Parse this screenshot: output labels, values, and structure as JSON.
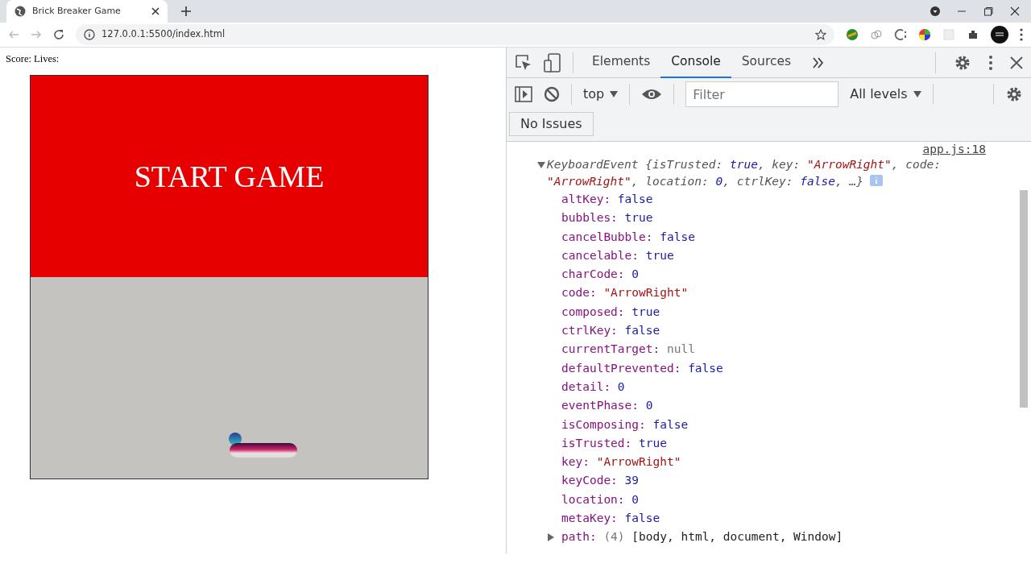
{
  "browser": {
    "tabs": [
      {
        "title": "Brick Breaker Game",
        "selected": true
      }
    ],
    "address": "127.0.0.1:5500/index.html"
  },
  "page": {
    "status": "Score: Lives:",
    "game": {
      "overlay_text": "START GAME"
    }
  },
  "devtools": {
    "tabs": [
      {
        "label": "Elements",
        "selected": false
      },
      {
        "label": "Console",
        "selected": true
      },
      {
        "label": "Sources",
        "selected": false
      }
    ],
    "context": "top",
    "filter": {
      "placeholder": "Filter"
    },
    "levels": "All levels",
    "issues": "No Issues",
    "log": {
      "source": "app.js:18",
      "expanded": true,
      "summary": [
        {
          "text": "KeyboardEvent {isTrusted: ",
          "kind": "plain"
        },
        {
          "text": "true",
          "kind": "value"
        },
        {
          "text": ", key: ",
          "kind": "plain"
        },
        {
          "text": "\"ArrowRight\"",
          "kind": "string"
        },
        {
          "text": ", code: ",
          "kind": "plain"
        },
        {
          "text": "\"ArrowRight\"",
          "kind": "string"
        },
        {
          "text": ", location: ",
          "kind": "plain"
        },
        {
          "text": "0",
          "kind": "value"
        },
        {
          "text": ", ctrlKey: ",
          "kind": "plain"
        },
        {
          "text": "false",
          "kind": "value"
        },
        {
          "text": ", …}",
          "kind": "plain"
        }
      ],
      "properties": [
        {
          "key": "altKey:",
          "value": "false",
          "kind": "value"
        },
        {
          "key": "bubbles:",
          "value": "true",
          "kind": "value"
        },
        {
          "key": "cancelBubble:",
          "value": "false",
          "kind": "value"
        },
        {
          "key": "cancelable:",
          "value": "true",
          "kind": "value"
        },
        {
          "key": "charCode:",
          "value": "0",
          "kind": "value"
        },
        {
          "key": "code:",
          "value": "\"ArrowRight\"",
          "kind": "string"
        },
        {
          "key": "composed:",
          "value": "true",
          "kind": "value"
        },
        {
          "key": "ctrlKey:",
          "value": "false",
          "kind": "value"
        },
        {
          "key": "currentTarget:",
          "value": "null",
          "kind": "null"
        },
        {
          "key": "defaultPrevented:",
          "value": "false",
          "kind": "value"
        },
        {
          "key": "detail:",
          "value": "0",
          "kind": "value"
        },
        {
          "key": "eventPhase:",
          "value": "0",
          "kind": "value"
        },
        {
          "key": "isComposing:",
          "value": "false",
          "kind": "value"
        },
        {
          "key": "isTrusted:",
          "value": "true",
          "kind": "value"
        },
        {
          "key": "key:",
          "value": "\"ArrowRight\"",
          "kind": "string"
        },
        {
          "key": "keyCode:",
          "value": "39",
          "kind": "value"
        },
        {
          "key": "location:",
          "value": "0",
          "kind": "value"
        },
        {
          "key": "metaKey:",
          "value": "false",
          "kind": "value"
        },
        {
          "key": "path:",
          "count": "(4)",
          "value": "[body, html, document, Window]",
          "kind": "array",
          "expanded": false
        }
      ]
    }
  }
}
